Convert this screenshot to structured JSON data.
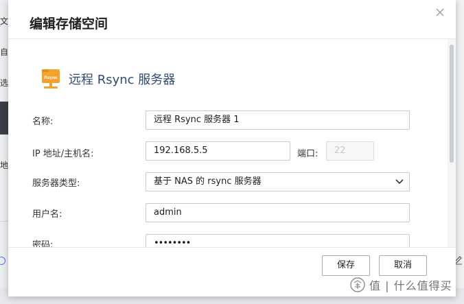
{
  "background": {
    "fragments": [
      "文",
      "自机",
      "选",
      "地"
    ]
  },
  "watermark": {
    "text": "值 | 什么值得买"
  },
  "dialog": {
    "title": "编辑存储空间",
    "server_heading": "远程 Rsync 服务器",
    "server_icon_label": "Rsync",
    "fields": {
      "name": {
        "label": "名称:",
        "value": "远程 Rsync 服务器 1"
      },
      "ip": {
        "label": "IP 地址/主机名:",
        "value": "192.168.5.5"
      },
      "port": {
        "label": "端口:",
        "value": "22"
      },
      "server_type": {
        "label": "服务器类型:",
        "value": "基于 NAS 的 rsync 服务器"
      },
      "username": {
        "label": "用户名:",
        "value": "admin"
      },
      "password": {
        "label": "密码:",
        "value": "••••••••"
      }
    },
    "buttons": {
      "save": "保存",
      "cancel": "取消"
    }
  },
  "colors": {
    "accent": "#2f4a73",
    "icon_orange": "#f3a32a",
    "border": "#c6c9ce"
  }
}
